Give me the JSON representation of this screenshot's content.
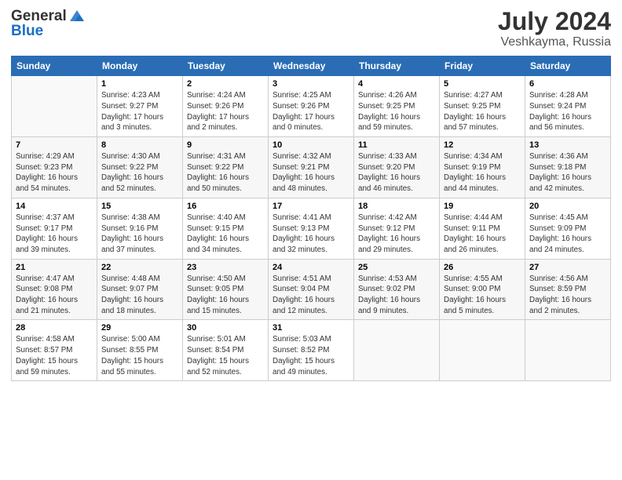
{
  "header": {
    "logo_general": "General",
    "logo_blue": "Blue",
    "main_title": "July 2024",
    "subtitle": "Veshkayma, Russia"
  },
  "weekdays": [
    "Sunday",
    "Monday",
    "Tuesday",
    "Wednesday",
    "Thursday",
    "Friday",
    "Saturday"
  ],
  "weeks": [
    [
      {
        "day": "",
        "info": ""
      },
      {
        "day": "1",
        "info": "Sunrise: 4:23 AM\nSunset: 9:27 PM\nDaylight: 17 hours\nand 3 minutes."
      },
      {
        "day": "2",
        "info": "Sunrise: 4:24 AM\nSunset: 9:26 PM\nDaylight: 17 hours\nand 2 minutes."
      },
      {
        "day": "3",
        "info": "Sunrise: 4:25 AM\nSunset: 9:26 PM\nDaylight: 17 hours\nand 0 minutes."
      },
      {
        "day": "4",
        "info": "Sunrise: 4:26 AM\nSunset: 9:25 PM\nDaylight: 16 hours\nand 59 minutes."
      },
      {
        "day": "5",
        "info": "Sunrise: 4:27 AM\nSunset: 9:25 PM\nDaylight: 16 hours\nand 57 minutes."
      },
      {
        "day": "6",
        "info": "Sunrise: 4:28 AM\nSunset: 9:24 PM\nDaylight: 16 hours\nand 56 minutes."
      }
    ],
    [
      {
        "day": "7",
        "info": "Sunrise: 4:29 AM\nSunset: 9:23 PM\nDaylight: 16 hours\nand 54 minutes."
      },
      {
        "day": "8",
        "info": "Sunrise: 4:30 AM\nSunset: 9:22 PM\nDaylight: 16 hours\nand 52 minutes."
      },
      {
        "day": "9",
        "info": "Sunrise: 4:31 AM\nSunset: 9:22 PM\nDaylight: 16 hours\nand 50 minutes."
      },
      {
        "day": "10",
        "info": "Sunrise: 4:32 AM\nSunset: 9:21 PM\nDaylight: 16 hours\nand 48 minutes."
      },
      {
        "day": "11",
        "info": "Sunrise: 4:33 AM\nSunset: 9:20 PM\nDaylight: 16 hours\nand 46 minutes."
      },
      {
        "day": "12",
        "info": "Sunrise: 4:34 AM\nSunset: 9:19 PM\nDaylight: 16 hours\nand 44 minutes."
      },
      {
        "day": "13",
        "info": "Sunrise: 4:36 AM\nSunset: 9:18 PM\nDaylight: 16 hours\nand 42 minutes."
      }
    ],
    [
      {
        "day": "14",
        "info": "Sunrise: 4:37 AM\nSunset: 9:17 PM\nDaylight: 16 hours\nand 39 minutes."
      },
      {
        "day": "15",
        "info": "Sunrise: 4:38 AM\nSunset: 9:16 PM\nDaylight: 16 hours\nand 37 minutes."
      },
      {
        "day": "16",
        "info": "Sunrise: 4:40 AM\nSunset: 9:15 PM\nDaylight: 16 hours\nand 34 minutes."
      },
      {
        "day": "17",
        "info": "Sunrise: 4:41 AM\nSunset: 9:13 PM\nDaylight: 16 hours\nand 32 minutes."
      },
      {
        "day": "18",
        "info": "Sunrise: 4:42 AM\nSunset: 9:12 PM\nDaylight: 16 hours\nand 29 minutes."
      },
      {
        "day": "19",
        "info": "Sunrise: 4:44 AM\nSunset: 9:11 PM\nDaylight: 16 hours\nand 26 minutes."
      },
      {
        "day": "20",
        "info": "Sunrise: 4:45 AM\nSunset: 9:09 PM\nDaylight: 16 hours\nand 24 minutes."
      }
    ],
    [
      {
        "day": "21",
        "info": "Sunrise: 4:47 AM\nSunset: 9:08 PM\nDaylight: 16 hours\nand 21 minutes."
      },
      {
        "day": "22",
        "info": "Sunrise: 4:48 AM\nSunset: 9:07 PM\nDaylight: 16 hours\nand 18 minutes."
      },
      {
        "day": "23",
        "info": "Sunrise: 4:50 AM\nSunset: 9:05 PM\nDaylight: 16 hours\nand 15 minutes."
      },
      {
        "day": "24",
        "info": "Sunrise: 4:51 AM\nSunset: 9:04 PM\nDaylight: 16 hours\nand 12 minutes."
      },
      {
        "day": "25",
        "info": "Sunrise: 4:53 AM\nSunset: 9:02 PM\nDaylight: 16 hours\nand 9 minutes."
      },
      {
        "day": "26",
        "info": "Sunrise: 4:55 AM\nSunset: 9:00 PM\nDaylight: 16 hours\nand 5 minutes."
      },
      {
        "day": "27",
        "info": "Sunrise: 4:56 AM\nSunset: 8:59 PM\nDaylight: 16 hours\nand 2 minutes."
      }
    ],
    [
      {
        "day": "28",
        "info": "Sunrise: 4:58 AM\nSunset: 8:57 PM\nDaylight: 15 hours\nand 59 minutes."
      },
      {
        "day": "29",
        "info": "Sunrise: 5:00 AM\nSunset: 8:55 PM\nDaylight: 15 hours\nand 55 minutes."
      },
      {
        "day": "30",
        "info": "Sunrise: 5:01 AM\nSunset: 8:54 PM\nDaylight: 15 hours\nand 52 minutes."
      },
      {
        "day": "31",
        "info": "Sunrise: 5:03 AM\nSunset: 8:52 PM\nDaylight: 15 hours\nand 49 minutes."
      },
      {
        "day": "",
        "info": ""
      },
      {
        "day": "",
        "info": ""
      },
      {
        "day": "",
        "info": ""
      }
    ]
  ]
}
